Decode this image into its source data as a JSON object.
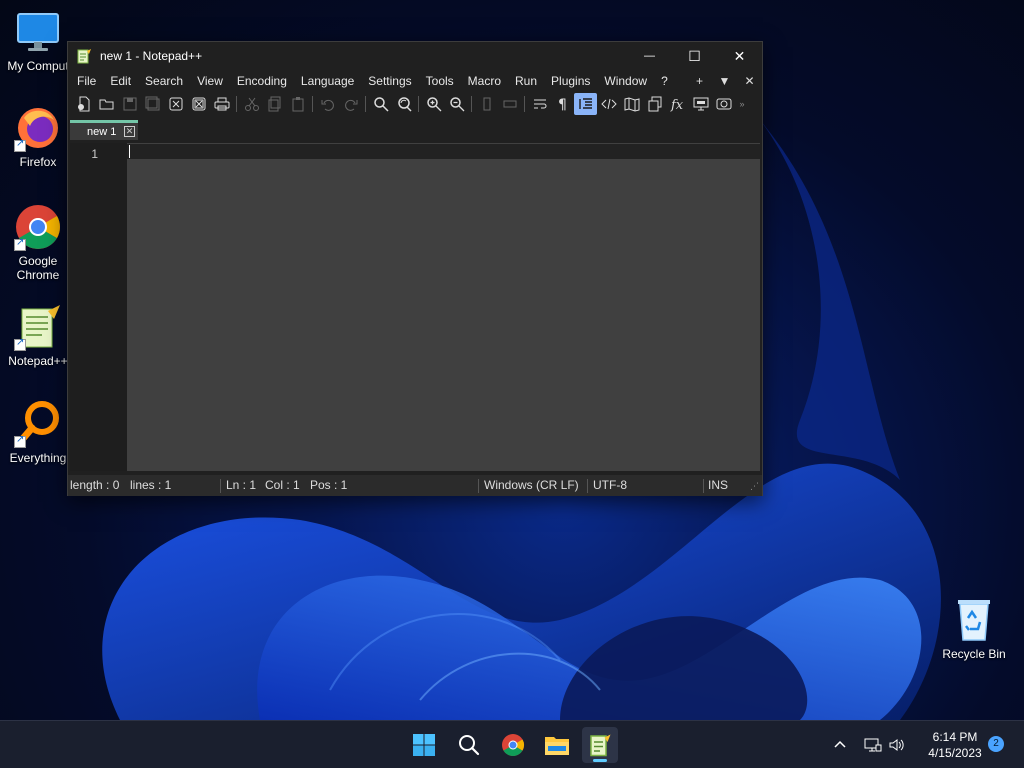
{
  "desktop": {
    "icons": [
      {
        "label": "My Comput"
      },
      {
        "label": "Firefox"
      },
      {
        "label": "Google Chrome"
      },
      {
        "label": "Notepad++"
      },
      {
        "label": "Everything"
      },
      {
        "label": "Recycle Bin"
      }
    ]
  },
  "window": {
    "title": "new 1 - Notepad++",
    "controls": {
      "minimize": "—",
      "maximize": "☐",
      "close": "✕"
    },
    "menu": [
      "File",
      "Edit",
      "Search",
      "View",
      "Encoding",
      "Language",
      "Settings",
      "Tools",
      "Macro",
      "Run",
      "Plugins",
      "Window",
      "?"
    ],
    "menu_right": [
      "+",
      "▼",
      "✕"
    ],
    "tab": {
      "label": "new 1",
      "close": "✕"
    },
    "editor": {
      "line_number": "1"
    },
    "status": {
      "length": "length : 0",
      "lines": "lines : 1",
      "ln": "Ln : 1",
      "col": "Col : 1",
      "pos": "Pos : 1",
      "eol": "Windows (CR LF)",
      "encoding": "UTF-8",
      "mode": "INS"
    }
  },
  "taskbar": {
    "clock_time": "6:14 PM",
    "clock_date": "4/15/2023",
    "notification_count": "2"
  },
  "colors": {
    "accent_tab": "#74c6a8",
    "editor_bg": "#404040",
    "taskbar_bg": "#1a1f2e"
  }
}
